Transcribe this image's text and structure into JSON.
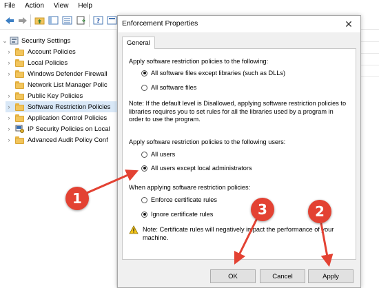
{
  "menu": [
    "File",
    "Action",
    "View",
    "Help"
  ],
  "tree": {
    "root": "Security Settings",
    "items": [
      {
        "label": "Account Policies"
      },
      {
        "label": "Local Policies"
      },
      {
        "label": "Windows Defender Firewall"
      },
      {
        "label": "Network List Manager Polic"
      },
      {
        "label": "Public Key Policies"
      },
      {
        "label": "Software Restriction Policies"
      },
      {
        "label": "Application Control Policies"
      },
      {
        "label": "IP Security Policies on Local"
      },
      {
        "label": "Advanced Audit Policy Conf"
      }
    ]
  },
  "dialog": {
    "title": "Enforcement Properties",
    "tab": "General",
    "apply_to_label": "Apply software restriction policies to the following:",
    "apply_to_options": [
      "All software files except libraries (such as DLLs)",
      "All software files"
    ],
    "note": "Note:  If the default level is Disallowed, applying software restriction policies to libraries requires you to set rules for all the libraries used by a program in order to use the program.",
    "users_label": "Apply software restriction policies to the following users:",
    "users_options": [
      "All users",
      "All users except local administrators"
    ],
    "cert_label": "When applying software restriction policies:",
    "cert_options": [
      "Enforce certificate rules",
      "Ignore certificate rules"
    ],
    "cert_note": "Note:  Certificate rules will negatively impact the performance of your machine.",
    "buttons": {
      "ok": "OK",
      "cancel": "Cancel",
      "apply": "Apply"
    }
  },
  "annotations": [
    "1",
    "2",
    "3"
  ],
  "colors": {
    "annotation": "#e34233",
    "folder": "#f2c55c",
    "selected": "#d9e8f7"
  }
}
